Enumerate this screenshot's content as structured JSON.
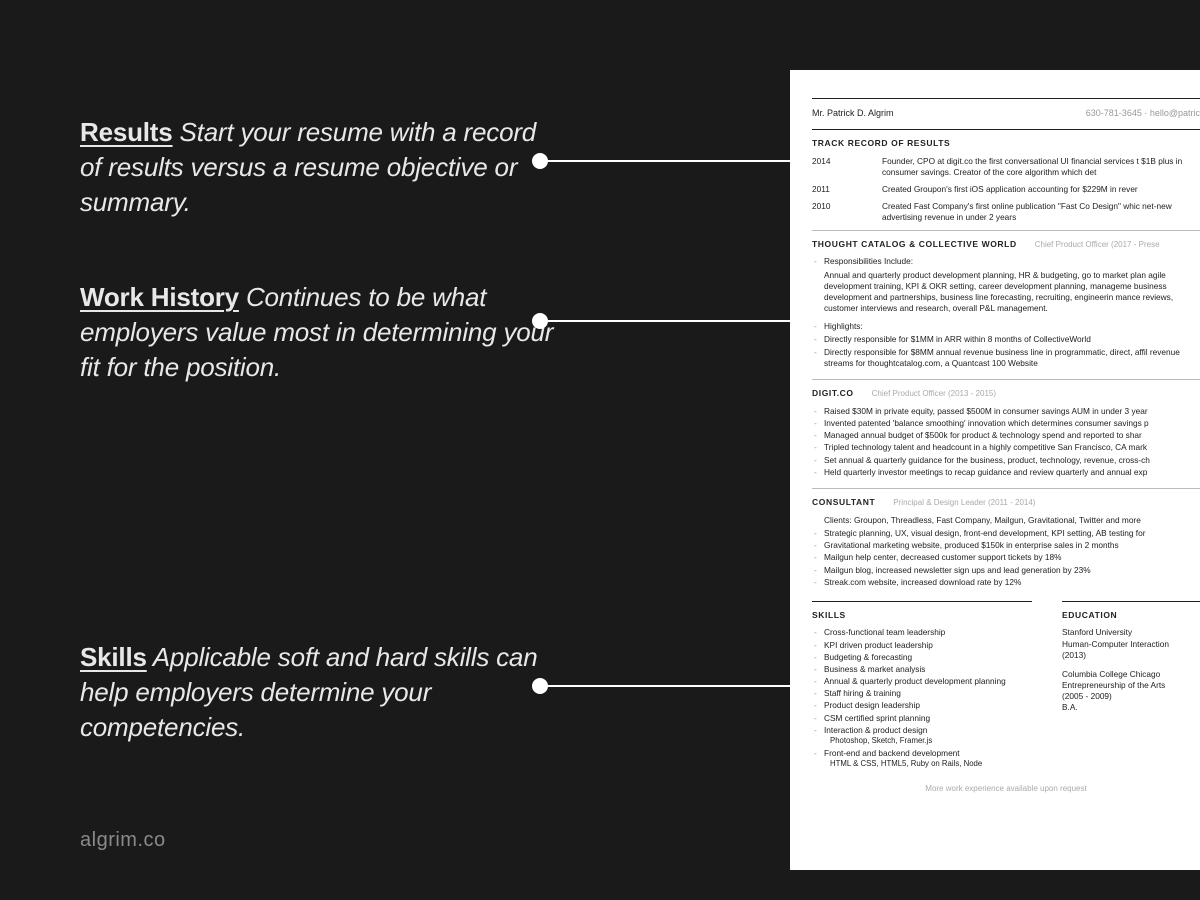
{
  "callouts": {
    "results": {
      "label": "Results",
      "text": " Start your resume with a record of results versus a resume objective or summary."
    },
    "work": {
      "label": "Work History",
      "text": " Continues to be what employers value most in determining your fit for the position."
    },
    "skills": {
      "label": "Skills",
      "text": " Applicable soft and hard skills can help employers determine your competencies."
    }
  },
  "brand": "algrim.co",
  "resume": {
    "name": "Mr. Patrick D. Algrim",
    "contact": "630-781-3645  ·  hello@patric",
    "track_title": "TRACK RECORD OF RESULTS",
    "track": [
      {
        "year": "2014",
        "text": "Founder, CPO at digit.co the first conversational UI financial services t $1B plus in consumer savings. Creator of the core algorithm which det"
      },
      {
        "year": "2011",
        "text": "Created Groupon's first iOS application accounting for $229M in rever"
      },
      {
        "year": "2010",
        "text": "Created Fast Company's first online publication \"Fast Co Design\" whic net-new advertising revenue in under 2 years"
      }
    ],
    "job1": {
      "title": "THOUGHT CATALOG & COLLECTIVE WORLD",
      "sub": "Chief Product Officer (2017 - Prese",
      "resp_label": "Responsibilities Include:",
      "resp": "Annual and quarterly product development planning,  HR & budgeting, go to market plan agile development training, KPI & OKR setting, career development planning, manageme business development and partnerships, business line forecasting, recruiting, engineerin mance reviews, customer interviews and research, overall P&L management.",
      "high_label": "Highlights:",
      "highlights": [
        "Directly responsible for $1MM in ARR within 8 months of CollectiveWorld",
        "Directly responsible for $8MM annual revenue business line in programmatic, direct, affil revenue streams for thoughtcatalog.com, a Quantcast 100 Website"
      ]
    },
    "job2": {
      "title": "DIGIT.CO",
      "sub": "Chief Product Officer (2013 - 2015)",
      "bullets": [
        "Raised $30M in private equity, passed $500M in consumer savings AUM in under 3 year",
        "Invented patented 'balance smoothing' innovation which determines consumer savings p",
        "Managed annual budget of $500k for product & technology spend and reported to shar",
        "Tripled technology talent and headcount in a highly competitive San Francisco, CA mark",
        "Set annual & quarterly guidance for the business, product, technology, revenue, cross-ch",
        "Held quarterly investor meetings to recap guidance and review quarterly and annual exp"
      ]
    },
    "job3": {
      "title": "CONSULTANT",
      "sub": "Principal  & Design Leader (2011 - 2014)",
      "lead": "Clients: Groupon, Threadless, Fast Company, Mailgun, Gravitational, Twitter and more",
      "bullets": [
        "Strategic planning, UX, visual design, front-end development, KPI setting, AB testing for",
        "Gravitational marketing website, produced $150k in enterprise sales in 2 months",
        "Mailgun help center, decreased customer support tickets by 18%",
        "Mailgun blog, increased newsletter sign ups and lead generation by 23%",
        "Streak.com website, increased download rate by 12%"
      ]
    },
    "skills_title": "SKILLS",
    "skills": [
      "Cross-functional team leadership",
      "KPI driven product leadership",
      "Budgeting & forecasting",
      "Business & market analysis",
      "Annual & quarterly product development planning",
      "Staff hiring & training",
      "Product design leadership",
      "CSM certified sprint planning",
      "Interaction & product design",
      "Front-end and backend development"
    ],
    "skills_sub1": "Photoshop, Sketch, Framer.js",
    "skills_sub2": "HTML & CSS, HTML5, Ruby on Rails, Node",
    "edu_title": "EDUCATION",
    "edu1_school": "Stanford University",
    "edu1_prog": "Human-Computer Interaction",
    "edu1_year": "(2013)",
    "edu2_school": "Columbia College Chicago",
    "edu2_prog": "Entrepreneurship of the Arts",
    "edu2_year": "(2005 - 2009)",
    "edu2_deg": "B.A.",
    "more": "More work experience available upon request"
  }
}
